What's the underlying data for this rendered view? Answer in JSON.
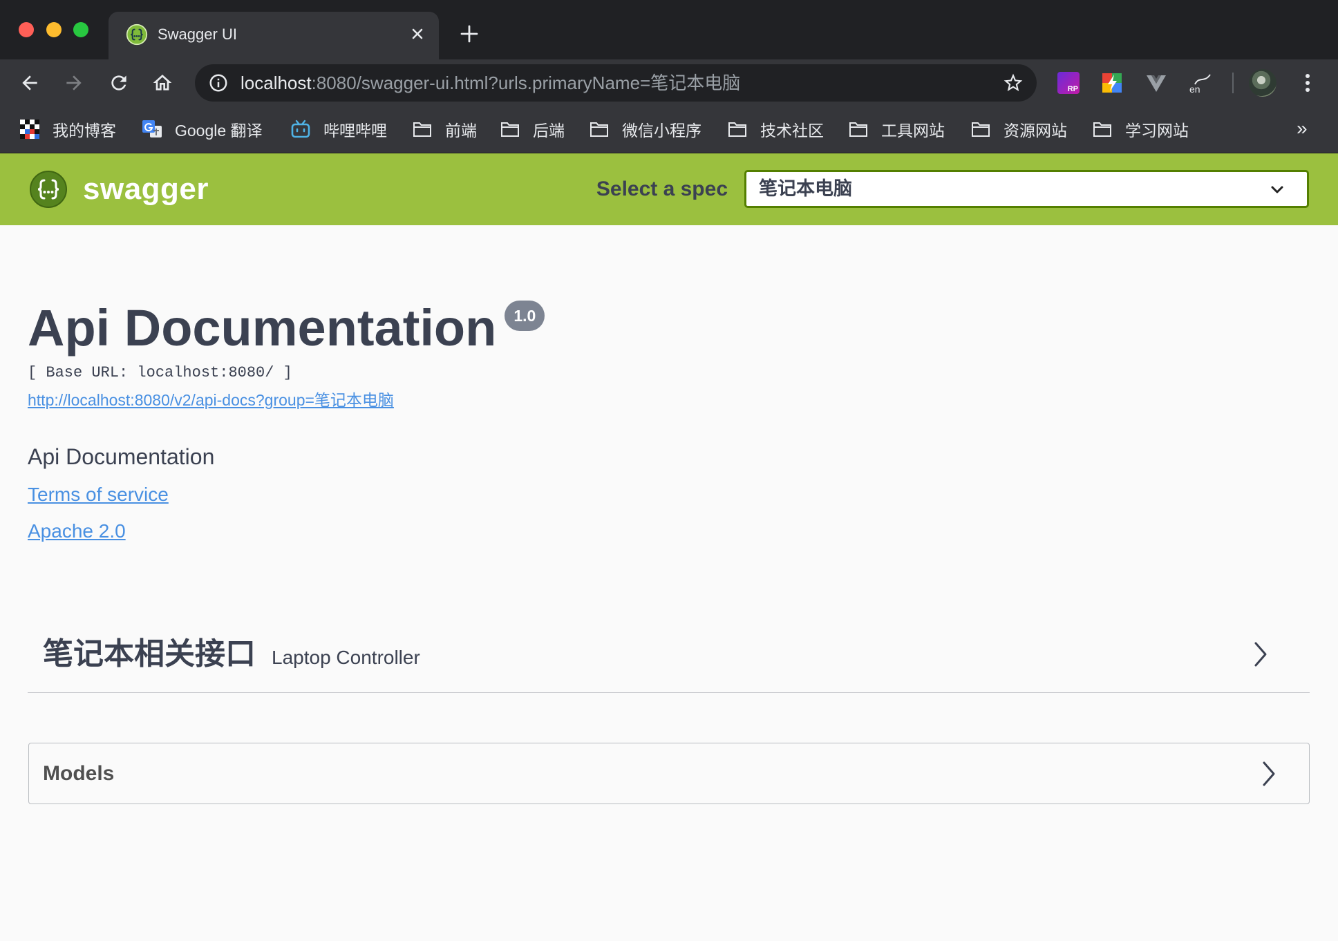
{
  "browser": {
    "tab_title": "Swagger UI",
    "url_host": "localhost",
    "url_path": ":8080/swagger-ui.html?urls.primaryName=笔记本电脑",
    "bookmarks": [
      {
        "label": "我的博客",
        "icon": "blog-logo-icon"
      },
      {
        "label": "Google 翻译",
        "icon": "google-translate-icon"
      },
      {
        "label": "哔哩哔哩",
        "icon": "bilibili-icon"
      },
      {
        "label": "前端",
        "icon": "folder-icon"
      },
      {
        "label": "后端",
        "icon": "folder-icon"
      },
      {
        "label": "微信小程序",
        "icon": "folder-icon"
      },
      {
        "label": "技术社区",
        "icon": "folder-icon"
      },
      {
        "label": "工具网站",
        "icon": "folder-icon"
      },
      {
        "label": "资源网站",
        "icon": "folder-icon"
      },
      {
        "label": "学习网站",
        "icon": "folder-icon"
      }
    ],
    "bookmarks_overflow": "»",
    "extensions": [
      {
        "icon": "axure-rp-icon",
        "badge": "RP"
      },
      {
        "icon": "rainbow-extension-icon"
      },
      {
        "icon": "vue-devtools-icon"
      },
      {
        "icon": "translate-extension-icon",
        "badge": "en"
      }
    ]
  },
  "topbar": {
    "logo_text": "swagger",
    "spec_label": "Select a spec",
    "spec_selected": "笔记本电脑"
  },
  "info": {
    "title": "Api Documentation",
    "version": "1.0",
    "base_url": "[ Base URL: localhost:8080/ ]",
    "spec_url": "http://localhost:8080/v2/api-docs?group=笔记本电脑",
    "description": "Api Documentation",
    "terms": "Terms of service",
    "license": "Apache 2.0"
  },
  "tag": {
    "name": "笔记本相关接口",
    "description": "Laptop Controller"
  },
  "models": {
    "label": "Models"
  },
  "colors": {
    "chrome_dark": "#202124",
    "chrome_toolbar": "#35363a",
    "topbar_green": "#9bc03f",
    "select_border": "#547f00",
    "link": "#4990e2",
    "text": "#3b4151",
    "version_badge": "#7d8492"
  }
}
